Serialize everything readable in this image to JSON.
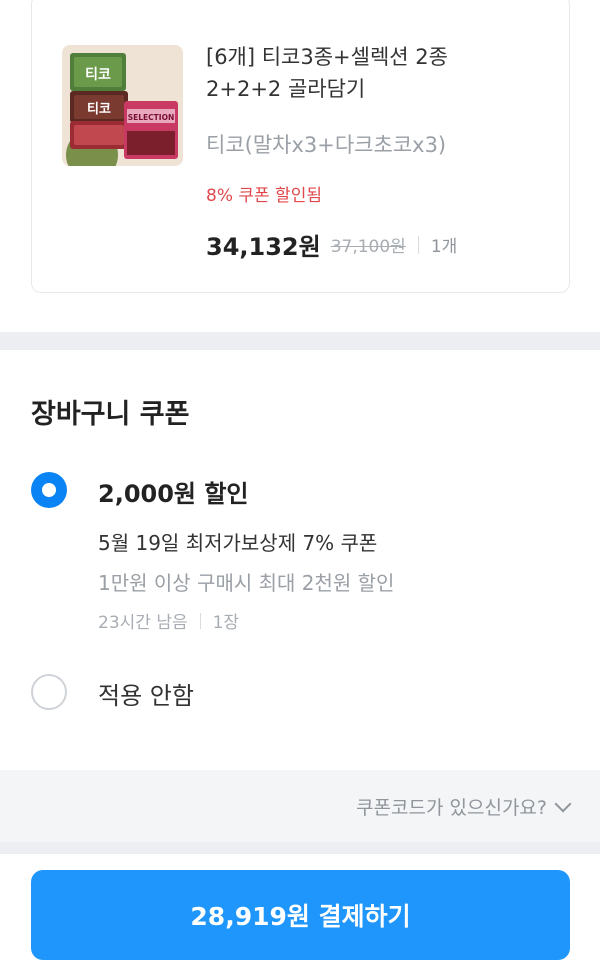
{
  "product": {
    "name_line1": "[6개] 티코3종+셀렉션 2종",
    "name_line2": "2+2+2 골라담기",
    "option": "티코(말차x3+다크초코x3)",
    "coupon_applied": "8% 쿠폰 할인됨",
    "price": "34,132원",
    "original_price": "37,100원",
    "quantity": "1개",
    "thumb_labels": [
      "티코",
      "티코",
      "SELECTION"
    ]
  },
  "cart_coupon": {
    "title": "장바구니 쿠폰",
    "options": [
      {
        "amount": "2,000원 할인",
        "name": "5월 19일 최저가보상제 7% 쿠폰",
        "condition": "1만원 이상 구매시 최대 2천원 할인",
        "time_left": "23시간 남음",
        "count": "1장",
        "selected": true
      },
      {
        "label": "적용 안함",
        "selected": false
      }
    ]
  },
  "coupon_code": {
    "link_label": "쿠폰코드가 있으신가요?"
  },
  "pay": {
    "button_label": "28,919원 결제하기"
  },
  "colors": {
    "accent": "#0a84f4",
    "pay_button": "#1e96fb",
    "discount_red": "#e0484c"
  }
}
